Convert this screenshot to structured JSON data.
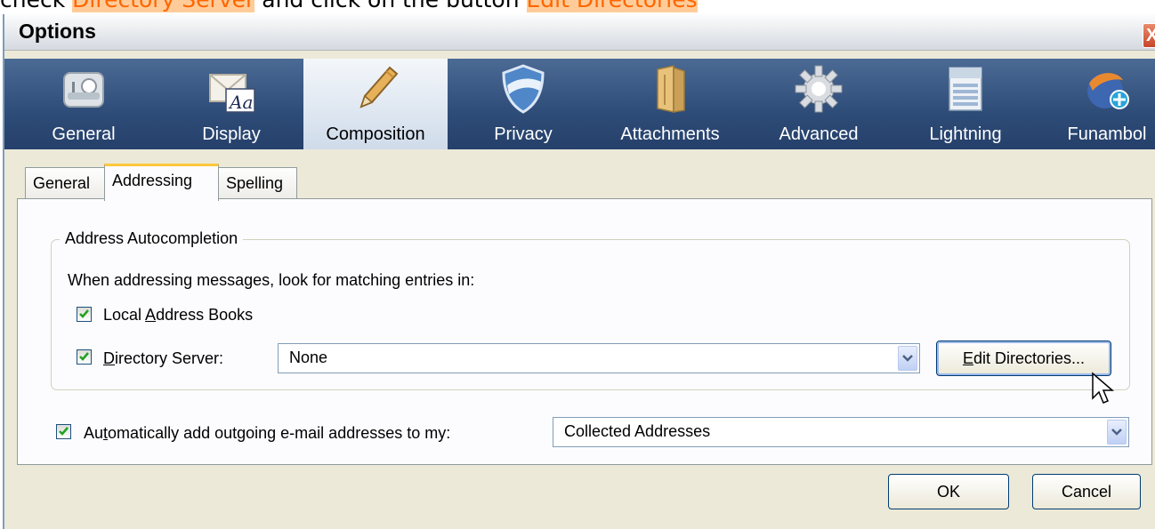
{
  "instruction": {
    "pre": "check ",
    "target1": "Directory Server",
    "mid": " and click on the button ",
    "target2": "Edit Directories"
  },
  "window": {
    "title": "Options",
    "close_glyph": "X"
  },
  "toolbar": {
    "items": [
      {
        "label": "General",
        "icon": "general-icon"
      },
      {
        "label": "Display",
        "icon": "display-icon"
      },
      {
        "label": "Composition",
        "icon": "pencil-icon"
      },
      {
        "label": "Privacy",
        "icon": "shield-icon"
      },
      {
        "label": "Attachments",
        "icon": "folder-icon"
      },
      {
        "label": "Advanced",
        "icon": "gear-icon"
      },
      {
        "label": "Lightning",
        "icon": "calendar-icon"
      },
      {
        "label": "Funambol",
        "icon": "funambol-icon"
      }
    ],
    "active": "Composition",
    "display_icon_text": "Aa"
  },
  "tabs": {
    "items": [
      "General",
      "Addressing",
      "Spelling"
    ],
    "active": "Addressing"
  },
  "autocompletion": {
    "legend": "Address Autocompletion",
    "description": "When addressing messages, look for matching entries in:",
    "local_books": {
      "pre": "Local ",
      "underline": "A",
      "post": "ddress Books",
      "checked": true
    },
    "directory_server": {
      "pre": "",
      "underline": "D",
      "post": "irectory Server:",
      "checked": true,
      "value": "None"
    },
    "edit_button": {
      "pre": "",
      "underline": "E",
      "post": "dit Directories..."
    }
  },
  "auto_add": {
    "pre": "Au",
    "underline": "t",
    "post": "omatically add outgoing e-mail addresses to my:",
    "checked": true,
    "value": "Collected Addresses"
  },
  "buttons": {
    "ok": "OK",
    "cancel": "Cancel"
  }
}
